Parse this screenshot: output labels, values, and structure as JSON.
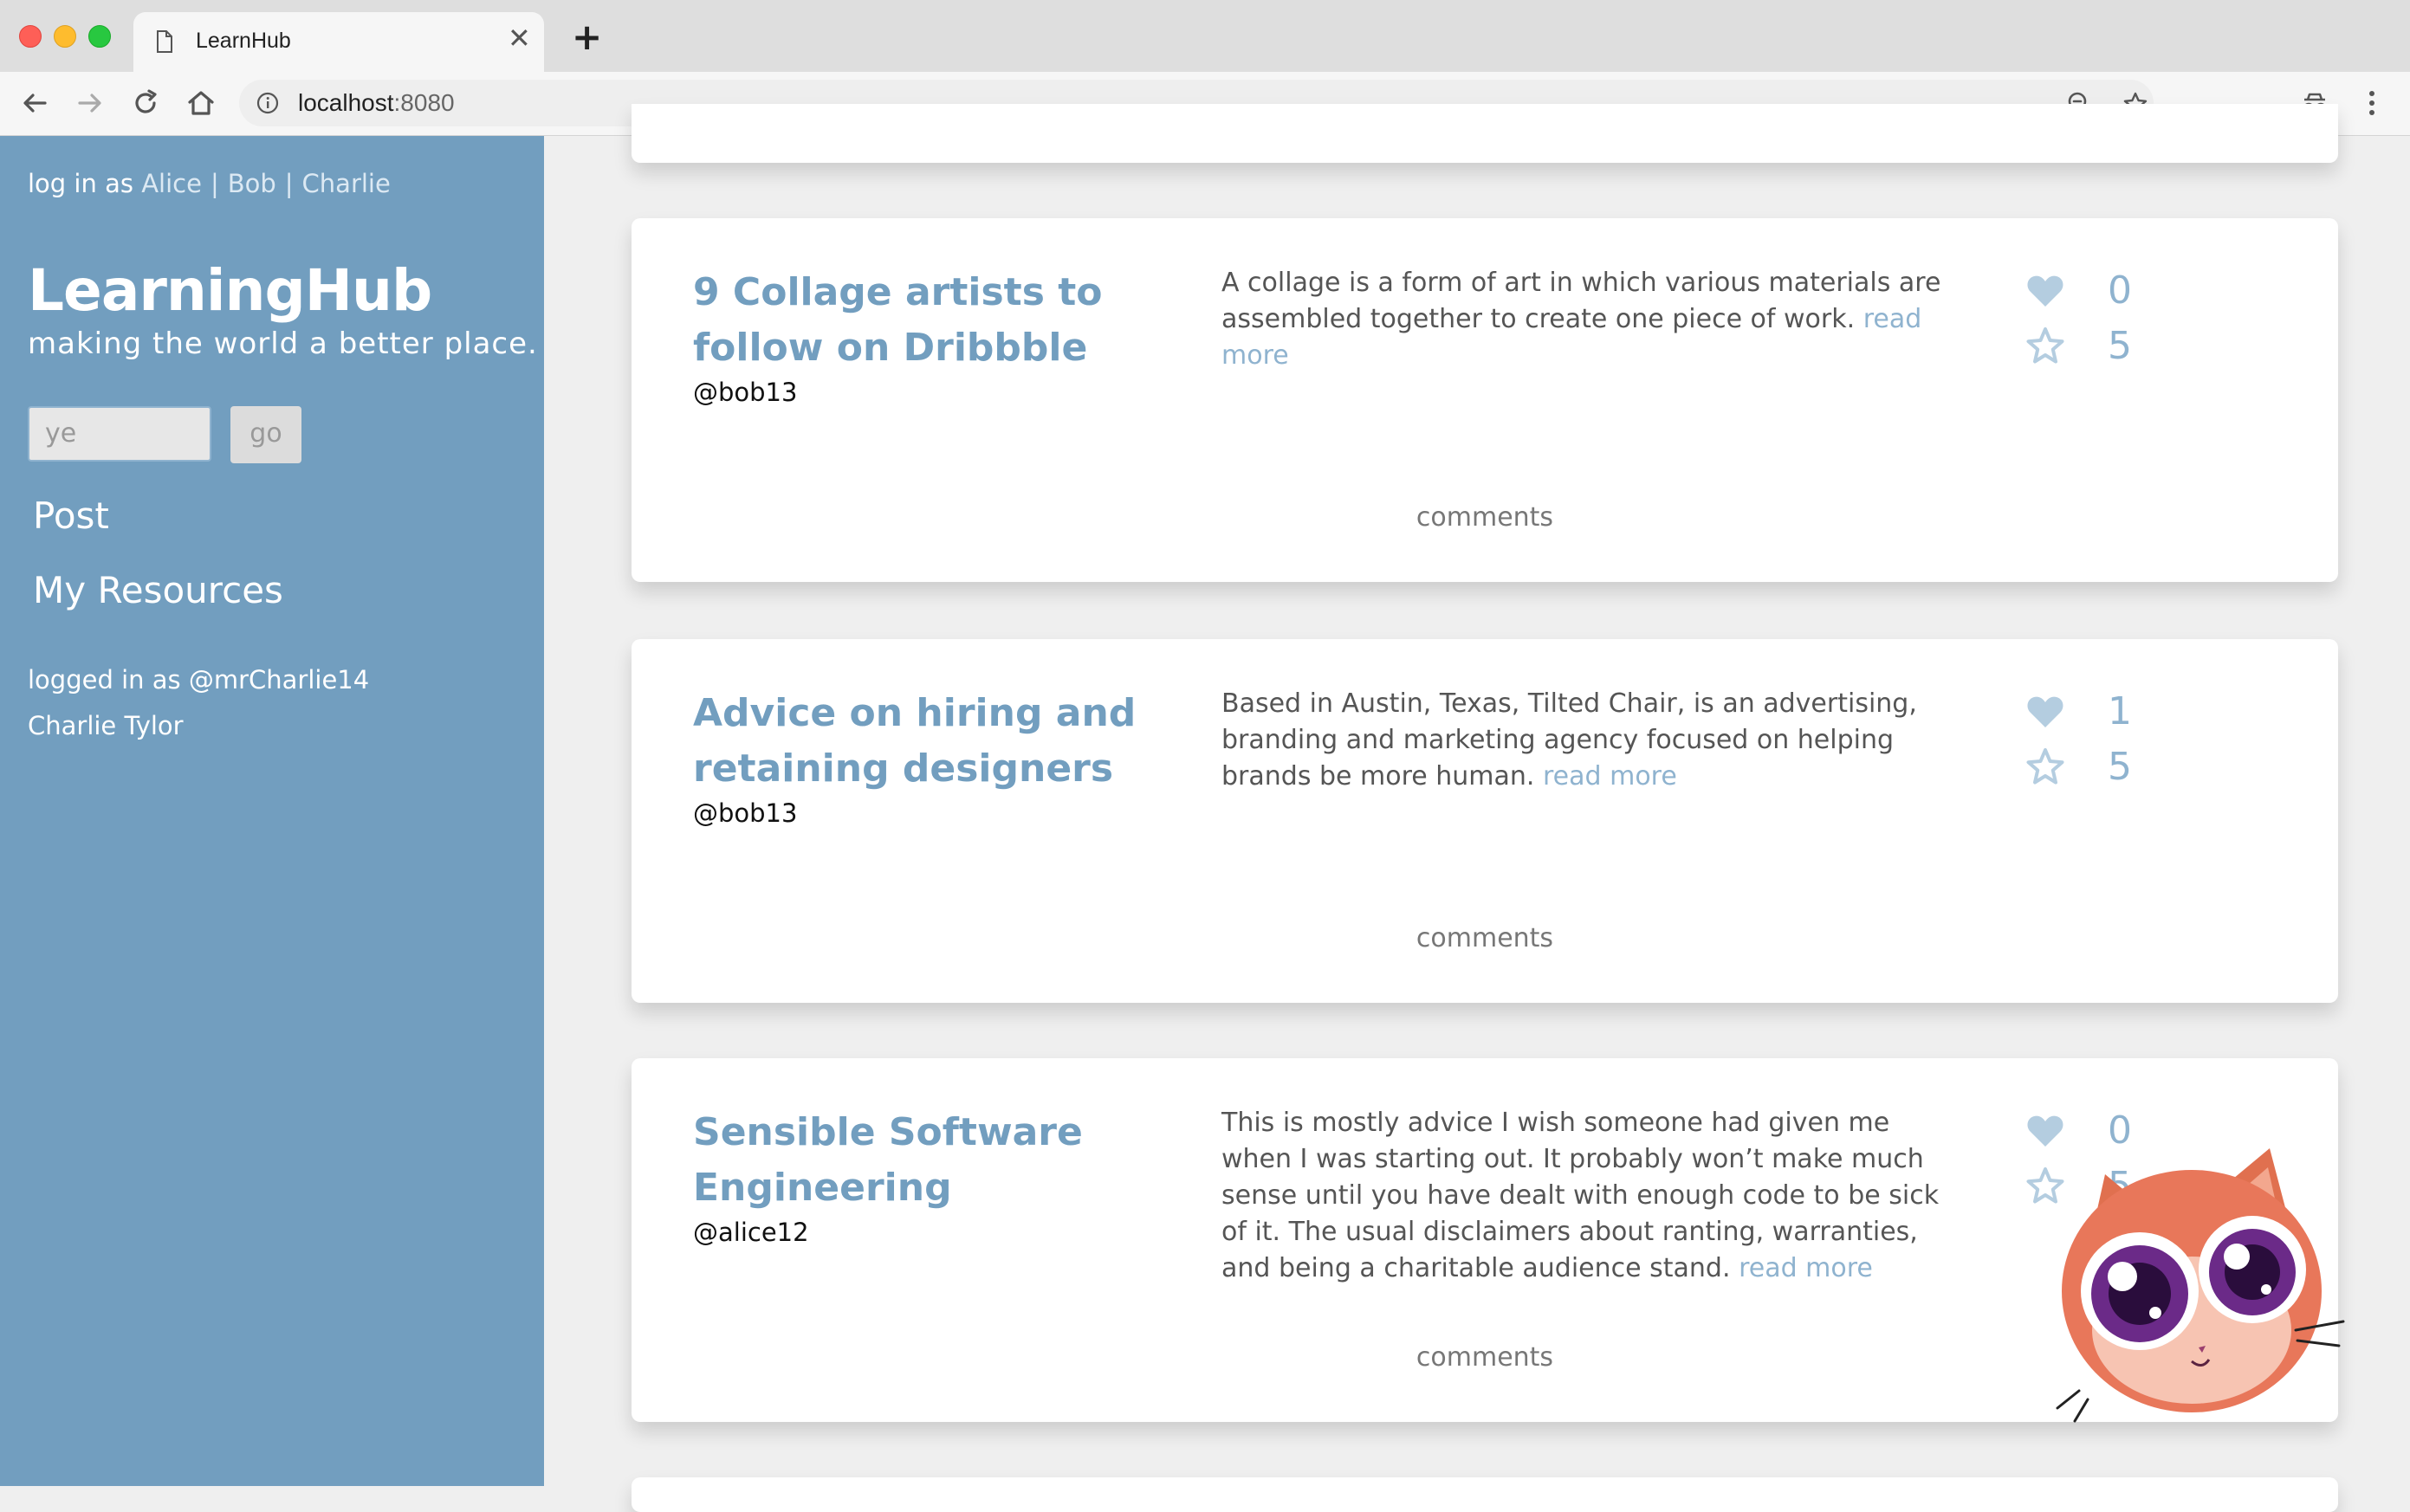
{
  "browser": {
    "tab_title": "LearnHub",
    "url_host": "localhost",
    "url_port": ":8080"
  },
  "sidebar": {
    "login_prefix": "log in as",
    "users": [
      "Alice",
      "Bob",
      "Charlie"
    ],
    "separator": "|",
    "brand": "LearningHub",
    "tagline": "making the world a better place.",
    "search_value": "ye",
    "search_button": "go",
    "nav": {
      "post": "Post",
      "resources": "My Resources"
    },
    "logged_in_line": "logged in as @mrCharlie14",
    "user_name": "Charlie Tylor"
  },
  "resources": [
    {
      "title": "9 Collage artists to follow on Dribbble",
      "author": "@bob13",
      "description": "A collage is a form of art in which various materials are assembled together to create one piece of work.",
      "read_more": "read more",
      "likes": "0",
      "stars": "5",
      "comments": "comments"
    },
    {
      "title": "Advice on hiring and retaining designers",
      "author": "@bob13",
      "description": "Based in Austin, Texas, Tilted Chair, is an advertising, branding and marketing agency focused on helping brands be more human.",
      "read_more": "read more",
      "likes": "1",
      "stars": "5",
      "comments": "comments"
    },
    {
      "title": "Sensible Software Engineering",
      "author": "@alice12",
      "description": "This is mostly advice I wish someone had given me when I was starting out. It probably won’t make much sense until you have dealt with enough code to be sick of it. The usual disclaimers about ranting, warranties, and being a charitable audience stand.",
      "read_more": "read more",
      "likes": "0",
      "stars": "5",
      "comments": "comments"
    }
  ],
  "colors": {
    "sidebar": "#729ebf",
    "accent": "#729ebf",
    "link": "#8fb3cf",
    "background": "#efefef"
  },
  "icons": [
    "heart-icon",
    "star-icon",
    "cat-sticker"
  ]
}
